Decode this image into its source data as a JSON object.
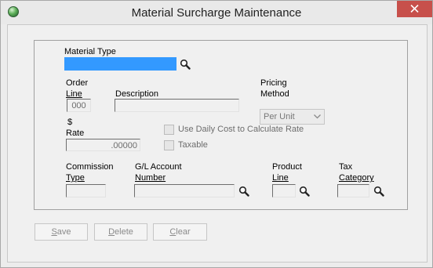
{
  "window": {
    "title": "Material Surcharge Maintenance"
  },
  "form": {
    "material_type": {
      "label": "Material Type",
      "value": ""
    },
    "order_line": {
      "label_1": "Order",
      "label_2": "Line",
      "value": "000"
    },
    "description": {
      "label": "Description",
      "value": ""
    },
    "pricing_method": {
      "label_1": "Pricing",
      "label_2": "Method",
      "value": "Per Unit"
    },
    "rate": {
      "label_1": "$",
      "label_2": "Rate",
      "value": ".00000"
    },
    "use_daily_cost": {
      "label": "Use Daily Cost to Calculate Rate",
      "checked": false
    },
    "taxable": {
      "label": "Taxable",
      "checked": false
    },
    "commission_type": {
      "label_1": "Commission",
      "label_2": "Type",
      "value": ""
    },
    "gl_account": {
      "label_1": "G/L Account",
      "label_2": "Number",
      "value": ""
    },
    "product_line": {
      "label_1": "Product",
      "label_2": "Line",
      "value": ""
    },
    "tax_category": {
      "label_1": "Tax",
      "label_2": "Category",
      "value": ""
    }
  },
  "buttons": {
    "save_first": "S",
    "save_rest": "ave",
    "delete_first": "D",
    "delete_rest": "elete",
    "clear_first": "C",
    "clear_rest": "lear"
  },
  "icons": {
    "app": "app-globe-icon",
    "close": "close-icon",
    "search": "magnifier-icon",
    "dropdown": "chevron-down-icon"
  },
  "colors": {
    "selection": "#3399ff",
    "close_button": "#c7504b"
  }
}
